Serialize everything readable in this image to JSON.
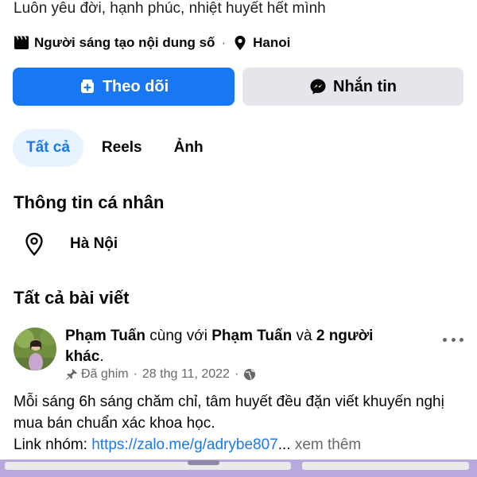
{
  "profile": {
    "bio": "Luôn yêu đời, hạnh phúc, nhiệt huyết hết mình",
    "role": "Người sáng tạo nội dung số",
    "separator": "·",
    "location": "Hanoi"
  },
  "actions": {
    "follow_label": "Theo dõi",
    "message_label": "Nhắn tin"
  },
  "tabs": [
    {
      "label": "Tất cả",
      "active": true
    },
    {
      "label": "Reels",
      "active": false
    },
    {
      "label": "Ảnh",
      "active": false
    }
  ],
  "about": {
    "title": "Thông tin cá nhân",
    "city": "Hà Nội"
  },
  "posts_section": {
    "title": "Tất cả bài viết"
  },
  "post": {
    "author": "Phạm Tuấn",
    "with_text": " cùng với ",
    "tagged": "Phạm Tuấn",
    "and_text": " và ",
    "others": "2 người khác",
    "end_punct": ".",
    "pinned": "Đã ghim",
    "sep1": "·",
    "date": "28 thg 11, 2022",
    "sep2": "·",
    "body_line": "Mỗi sáng 6h sáng chăm chỉ, tâm huyết đều đặn viết khuyến nghị mua bán chuẩn xác khoa học.",
    "link_prefix": "Link nhóm: ",
    "link_text": "https://zalo.me/g/adrybe807",
    "ellipsis": "...",
    "see_more": " xem thêm"
  },
  "colors": {
    "accent": "#1877f2",
    "secondary_button": "#e4e6eb",
    "active_tab_bg": "#e7f3ff",
    "muted_text": "#65676b"
  },
  "icons": [
    "clapperboard-icon",
    "location-pin-icon",
    "add-friend-icon",
    "messenger-icon",
    "pin-icon",
    "globe-icon",
    "more-icon"
  ]
}
